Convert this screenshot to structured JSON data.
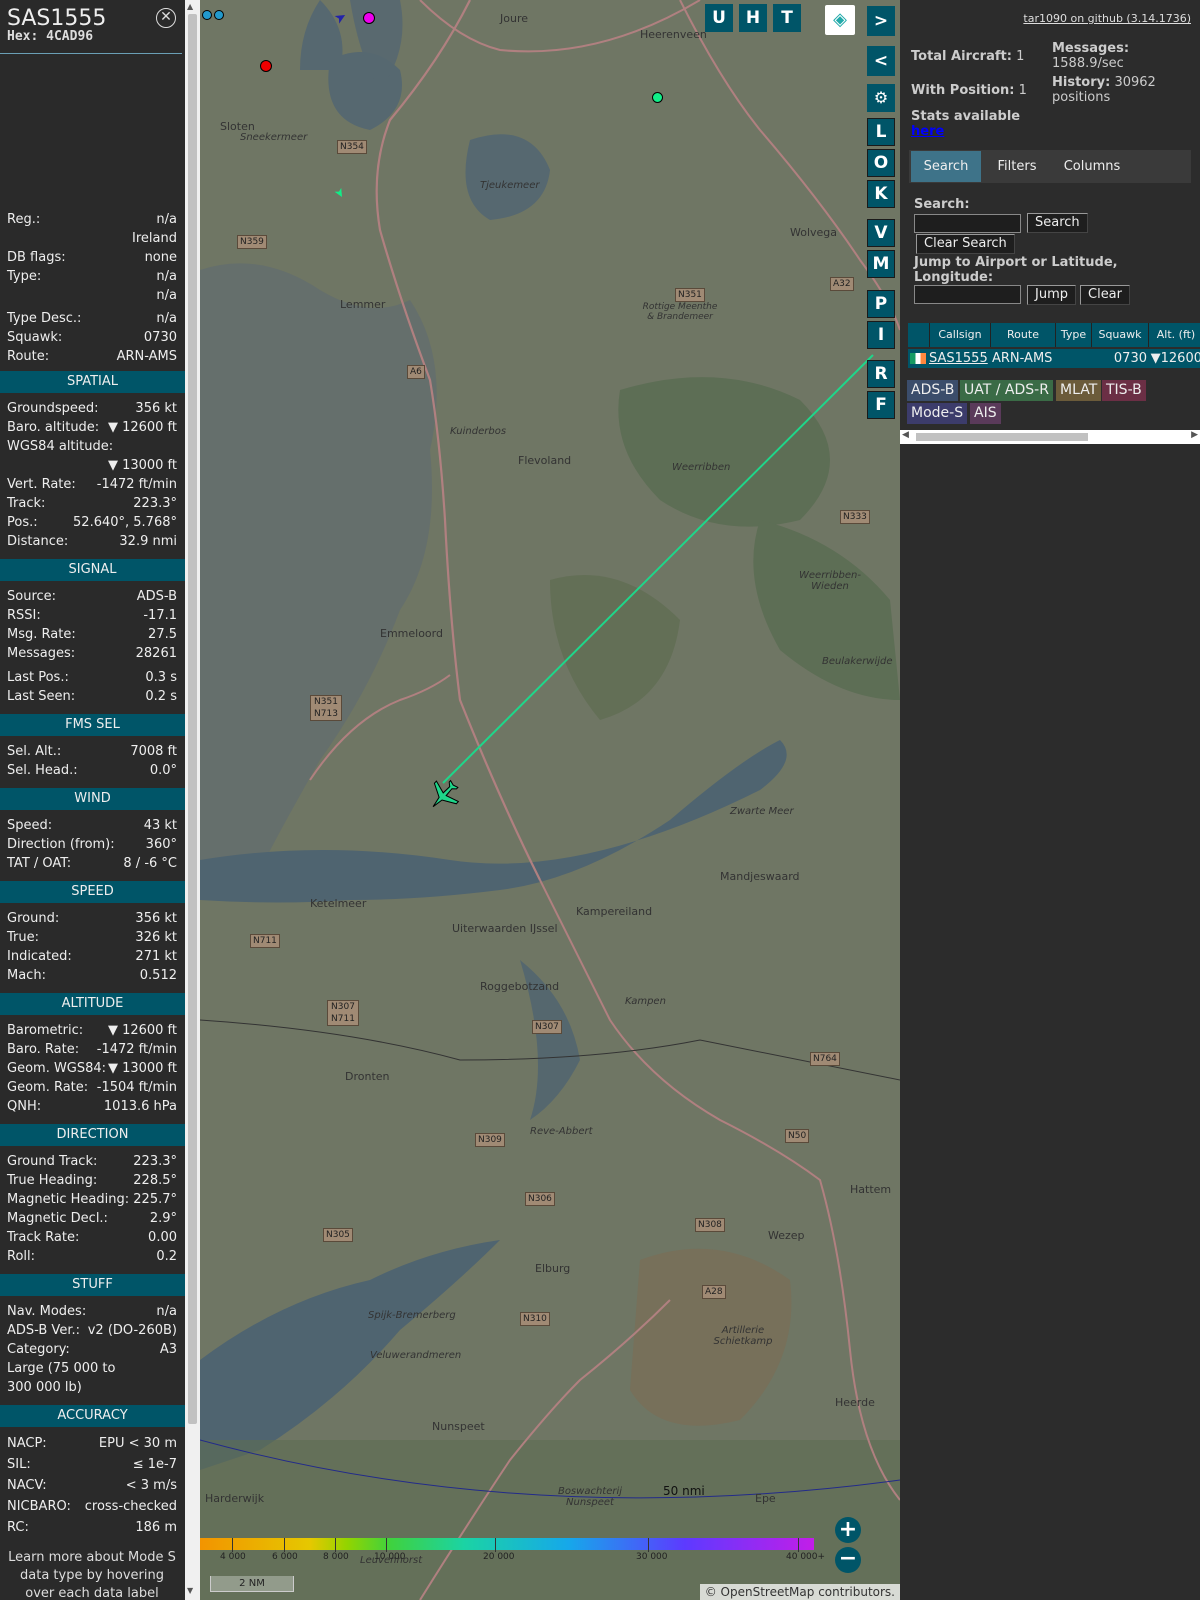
{
  "aircraft": {
    "callsign": "SAS1555",
    "hex_label": "Hex:",
    "hex": "4CAD96"
  },
  "details": [
    {
      "label": "Reg.:",
      "value": "n/a"
    },
    {
      "label": "",
      "value": "Ireland"
    },
    {
      "label": "DB flags:",
      "value": "none"
    },
    {
      "label": "Type:",
      "value": "n/a"
    },
    {
      "label": "",
      "value": "n/a"
    },
    {
      "label": "Type Desc.:",
      "value": "n/a"
    },
    {
      "label": "Squawk:",
      "value": "0730"
    },
    {
      "label": "Route:",
      "value": "ARN-AMS"
    }
  ],
  "sections": [
    {
      "title": "SPATIAL",
      "rows": [
        {
          "label": "Groundspeed:",
          "value": "356 kt"
        },
        {
          "label": "Baro. altitude:",
          "value": "▼ 12600 ft"
        },
        {
          "label": "WGS84 altitude:",
          "value": ""
        },
        {
          "label": "",
          "value": "▼ 13000 ft"
        },
        {
          "label": "Vert. Rate:",
          "value": "-1472 ft/min"
        },
        {
          "label": "Track:",
          "value": "223.3°"
        },
        {
          "label": "Pos.:",
          "value": "52.640°, 5.768°"
        },
        {
          "label": "Distance:",
          "value": "32.9 nmi"
        }
      ]
    },
    {
      "title": "SIGNAL",
      "rows": [
        {
          "label": "Source:",
          "value": "ADS-B"
        },
        {
          "label": "RSSI:",
          "value": "-17.1"
        },
        {
          "label": "Msg. Rate:",
          "value": "27.5"
        },
        {
          "label": "Messages:",
          "value": "28261"
        },
        {
          "label": "Last Pos.:",
          "value": "0.3 s"
        },
        {
          "label": "Last Seen:",
          "value": "0.2 s"
        }
      ]
    },
    {
      "title": "FMS SEL",
      "rows": [
        {
          "label": "Sel. Alt.:",
          "value": "7008 ft"
        },
        {
          "label": "Sel. Head.:",
          "value": "0.0°"
        }
      ]
    },
    {
      "title": "WIND",
      "rows": [
        {
          "label": "Speed:",
          "value": "43 kt"
        },
        {
          "label": "Direction (from):",
          "value": "360°"
        },
        {
          "label": "TAT / OAT:",
          "value": "8 / -6 °C"
        }
      ]
    },
    {
      "title": "SPEED",
      "rows": [
        {
          "label": "Ground:",
          "value": "356 kt"
        },
        {
          "label": "True:",
          "value": "326 kt"
        },
        {
          "label": "Indicated:",
          "value": "271 kt"
        },
        {
          "label": "Mach:",
          "value": "0.512"
        }
      ]
    },
    {
      "title": "ALTITUDE",
      "rows": [
        {
          "label": "Barometric:",
          "value": "▼ 12600 ft"
        },
        {
          "label": "Baro. Rate:",
          "value": "-1472 ft/min"
        },
        {
          "label": "Geom. WGS84:",
          "value": "▼ 13000 ft"
        },
        {
          "label": "Geom. Rate:",
          "value": "-1504 ft/min"
        },
        {
          "label": "QNH:",
          "value": "1013.6 hPa"
        }
      ]
    },
    {
      "title": "DIRECTION",
      "rows": [
        {
          "label": "Ground Track:",
          "value": "223.3°"
        },
        {
          "label": "True Heading:",
          "value": "228.5°"
        },
        {
          "label": "Magnetic Heading:",
          "value": "225.7°"
        },
        {
          "label": "Magnetic Decl.:",
          "value": "2.9°"
        },
        {
          "label": "Track Rate:",
          "value": "0.00"
        },
        {
          "label": "Roll:",
          "value": "0.2"
        }
      ]
    },
    {
      "title": "STUFF",
      "rows": [
        {
          "label": "Nav. Modes:",
          "value": "n/a"
        },
        {
          "label": "ADS-B Ver.:",
          "value": "v2 (DO-260B)"
        },
        {
          "label": "Category:",
          "value": "A3"
        },
        {
          "label": "Large (75 000 to",
          "value": ""
        },
        {
          "label": "300 000 lb)",
          "value": ""
        }
      ]
    },
    {
      "title": "ACCURACY",
      "rows": [
        {
          "label": "NACP:",
          "value": "EPU < 30 m"
        },
        {
          "label": "SIL:",
          "value": "≤ 1e-7"
        },
        {
          "label": "NACV:",
          "value": "< 3 m/s"
        },
        {
          "label": "NICBARO:",
          "value": "cross-checked"
        },
        {
          "label": "RC:",
          "value": "186 m"
        }
      ]
    }
  ],
  "footer_note": "Learn more about Mode S data type by hovering over each data label",
  "map": {
    "top_buttons": [
      "U",
      "H",
      "T"
    ],
    "side_buttons": [
      "L",
      "O",
      "K",
      "V",
      "M",
      "P",
      "I",
      "R",
      "F"
    ],
    "scale_label": "2 NM",
    "ring_label": "50 nmi",
    "attribution_prefix": "© ",
    "attribution_link": "OpenStreetMap",
    "attribution_suffix": " contributors.",
    "altitude_ticks": [
      "4 000",
      "6 000",
      "8 000",
      "10 000",
      "20 000",
      "30 000",
      "40 000+"
    ],
    "places": [
      "Joure",
      "Heerenveen",
      "Sloten",
      "Sneekermeer",
      "Tjeukemeer",
      "Lemmer",
      "Wolvega",
      "Rottige Meenthe & Brandemeer",
      "Kuinderbos",
      "Flevoland",
      "Weerribben",
      "Weerribben-Wieden",
      "Emmeloord",
      "Zwarte Meer",
      "Mandjeswaard",
      "Kampereiland",
      "Ketelmeer",
      "Uiterwaarden IJssel",
      "Roggebotzand",
      "Kampen",
      "Dronten",
      "Reve-Abbert",
      "Hattem",
      "Wezep",
      "Elburg",
      "Spijk-Bremerberg",
      "Veluwerandmeren",
      "Artillerie Schietkamp",
      "Heerde",
      "Nunspeet",
      "Harderwijk",
      "Epe",
      "Boswachterij Nunspeet",
      "Leuvenhorst",
      "Beulakerwijde"
    ],
    "roads": [
      "N354",
      "N359",
      "A6",
      "N351",
      "A32",
      "N333",
      "N351 N713",
      "N711",
      "N307 N711",
      "N307",
      "N764",
      "N309",
      "N50",
      "N306",
      "N308",
      "N305",
      "A28",
      "N310"
    ],
    "colors": {
      "track": "#1fd68a",
      "aircraft": "#1fd68a",
      "panel": "#005568"
    }
  },
  "right": {
    "github_link": "tar1090 on github (3.14.1736)",
    "total_aircraft_label": "Total Aircraft:",
    "total_aircraft": "1",
    "with_position_label": "With Position:",
    "with_position": "1",
    "messages_label": "Messages:",
    "messages_rate": "1588.9/sec",
    "history_label": "History:",
    "history_value": "30962 positions",
    "stats_label": "Stats available",
    "stats_link": "here",
    "tabs": [
      "Search",
      "Filters",
      "Columns"
    ],
    "search_label": "Search:",
    "search_button": "Search",
    "clear_search_button": "Clear Search",
    "jump_label": "Jump to Airport or Latitude, Longitude:",
    "jump_button": "Jump",
    "clear_button": "Clear",
    "table_headers": [
      "Callsign",
      "Route",
      "Type",
      "Squawk",
      "Alt. (ft)"
    ],
    "table_rows": [
      {
        "callsign": "SAS1555",
        "route": "ARN-AMS",
        "type": "",
        "squawk": "0730",
        "alt": "▼12600"
      }
    ],
    "source_badges": [
      {
        "label": "ADS-B",
        "color": "#3b4d6b"
      },
      {
        "label": "UAT / ADS-R",
        "color": "#3a6b46"
      },
      {
        "label": "MLAT",
        "color": "#6b5b3a"
      },
      {
        "label": "TIS-B",
        "color": "#6b2f45"
      },
      {
        "label": "Mode-S",
        "color": "#3c3c6b"
      },
      {
        "label": "AIS",
        "color": "#5a3a5a"
      }
    ]
  }
}
